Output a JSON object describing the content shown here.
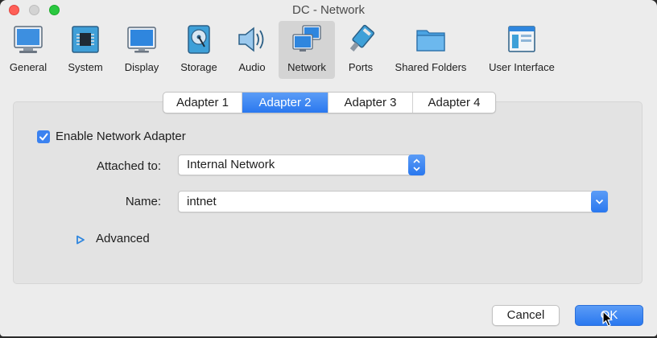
{
  "window": {
    "title": "DC - Network"
  },
  "toolbar": {
    "items": [
      {
        "label": "General",
        "icon": "general-icon"
      },
      {
        "label": "System",
        "icon": "system-chip-icon"
      },
      {
        "label": "Display",
        "icon": "display-monitor-icon"
      },
      {
        "label": "Storage",
        "icon": "storage-disk-icon"
      },
      {
        "label": "Audio",
        "icon": "audio-speaker-icon"
      },
      {
        "label": "Network",
        "icon": "network-icon",
        "selected": true
      },
      {
        "label": "Ports",
        "icon": "ports-connector-icon"
      },
      {
        "label": "Shared Folders",
        "icon": "shared-folder-icon"
      },
      {
        "label": "User Interface",
        "icon": "user-interface-icon"
      }
    ]
  },
  "tabs": [
    {
      "label": "Adapter 1"
    },
    {
      "label": "Adapter 2",
      "selected": true
    },
    {
      "label": "Adapter 3"
    },
    {
      "label": "Adapter 4"
    }
  ],
  "adapter": {
    "enable_label": "Enable Network Adapter",
    "enabled": true,
    "attached_label": "Attached to:",
    "attached_value": "Internal Network",
    "name_label": "Name:",
    "name_value": "intnet",
    "advanced_label": "Advanced"
  },
  "buttons": {
    "cancel": "Cancel",
    "ok": "OK"
  },
  "colors": {
    "accent": "#2a78ef",
    "background": "#ececec",
    "panel": "#e3e3e3"
  }
}
